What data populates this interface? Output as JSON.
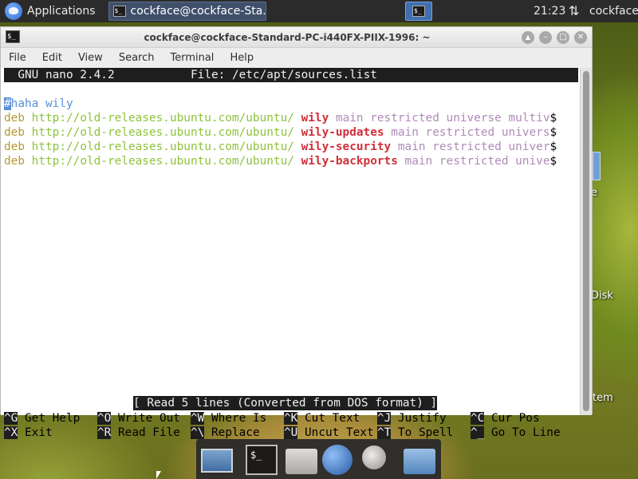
{
  "top_panel": {
    "applications_label": "Applications",
    "task_label": "cockface@cockface-Sta...",
    "clock": "21:23",
    "user": "cockface"
  },
  "window": {
    "title": "cockface@cockface-Standard-PC-i440FX-PIIX-1996: ~",
    "buttons": {
      "up": "▲",
      "minimize": "–",
      "maximize": "□",
      "close": "✕"
    },
    "menu": [
      "File",
      "Edit",
      "View",
      "Search",
      "Terminal",
      "Help"
    ]
  },
  "nano": {
    "version": "  GNU nano 2.4.2",
    "file_label": "File: /etc/apt/sources.list",
    "comment_cursor": "#",
    "comment_rest": "haha wily",
    "lines": [
      {
        "deb": "deb",
        "url": "http://old-releases.ubuntu.com/ubuntu/",
        "suite": "wily",
        "components": "main restricted universe multiv",
        "trunc": "$"
      },
      {
        "deb": "deb",
        "url": "http://old-releases.ubuntu.com/ubuntu/",
        "suite": "wily-updates",
        "components": "main restricted univers",
        "trunc": "$"
      },
      {
        "deb": "deb",
        "url": "http://old-releases.ubuntu.com/ubuntu/",
        "suite": "wily-security",
        "components": "main restricted univer",
        "trunc": "$"
      },
      {
        "deb": "deb",
        "url": "http://old-releases.ubuntu.com/ubuntu/",
        "suite": "wily-backports",
        "components": "main restricted unive",
        "trunc": "$"
      }
    ],
    "status": "[ Read 5 lines (Converted from DOS format) ]",
    "shortcuts": [
      {
        "key": "^G",
        "label": " Get Help"
      },
      {
        "key": "^O",
        "label": " Write Out"
      },
      {
        "key": "^W",
        "label": " Where Is"
      },
      {
        "key": "^K",
        "label": " Cut Text"
      },
      {
        "key": "^J",
        "label": " Justify"
      },
      {
        "key": "^C",
        "label": " Cur Pos"
      },
      {
        "key": "^X",
        "label": " Exit"
      },
      {
        "key": "^R",
        "label": " Read File"
      },
      {
        "key": "^\\",
        "label": " Replace"
      },
      {
        "key": "^U",
        "label": " Uncut Text"
      },
      {
        "key": "^T",
        "label": " To Spell"
      },
      {
        "key": "^_",
        "label": " Go To Line"
      }
    ]
  },
  "desktop": {
    "label_e": "e",
    "label_disk": "Disk",
    "label_tem": "tem"
  },
  "dock": {
    "terminal_glyph": "$_"
  }
}
